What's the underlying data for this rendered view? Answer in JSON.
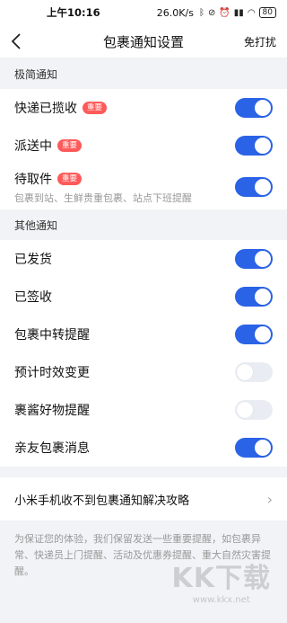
{
  "status": {
    "time": "上午10:16",
    "speed": "26.0K/s",
    "battery": "80"
  },
  "header": {
    "title": "包裹通知设置",
    "right_action": "免打扰"
  },
  "sections": [
    {
      "title": "极简通知",
      "items": [
        {
          "label": "快递已揽收",
          "badge": "重要",
          "sub": "",
          "on": true
        },
        {
          "label": "派送中",
          "badge": "重要",
          "sub": "",
          "on": true
        },
        {
          "label": "待取件",
          "badge": "重要",
          "sub": "包裹到站、生鲜贵重包裹、站点下班提醒",
          "on": true
        }
      ]
    },
    {
      "title": "其他通知",
      "items": [
        {
          "label": "已发货",
          "on": true
        },
        {
          "label": "已签收",
          "on": true
        },
        {
          "label": "包裹中转提醒",
          "on": true
        },
        {
          "label": "预计时效变更",
          "on": false
        },
        {
          "label": "裹酱好物提醒",
          "on": false
        },
        {
          "label": "亲友包裹消息",
          "on": true
        }
      ]
    }
  ],
  "help": {
    "label": "小米手机收不到包裹通知解决攻略"
  },
  "footer_text": "为保证您的体验，我们保留发送一些重要提醒，如包裹异常、快递员上门提醒、活动及优惠券提醒、重大自然灾害提醒。",
  "watermark": {
    "logo": "KK下载",
    "url": "www.kkx.net"
  },
  "colors": {
    "toggle_on": "#2a63e6",
    "toggle_off": "#e9edf3",
    "badge": "#ff5a5a"
  }
}
